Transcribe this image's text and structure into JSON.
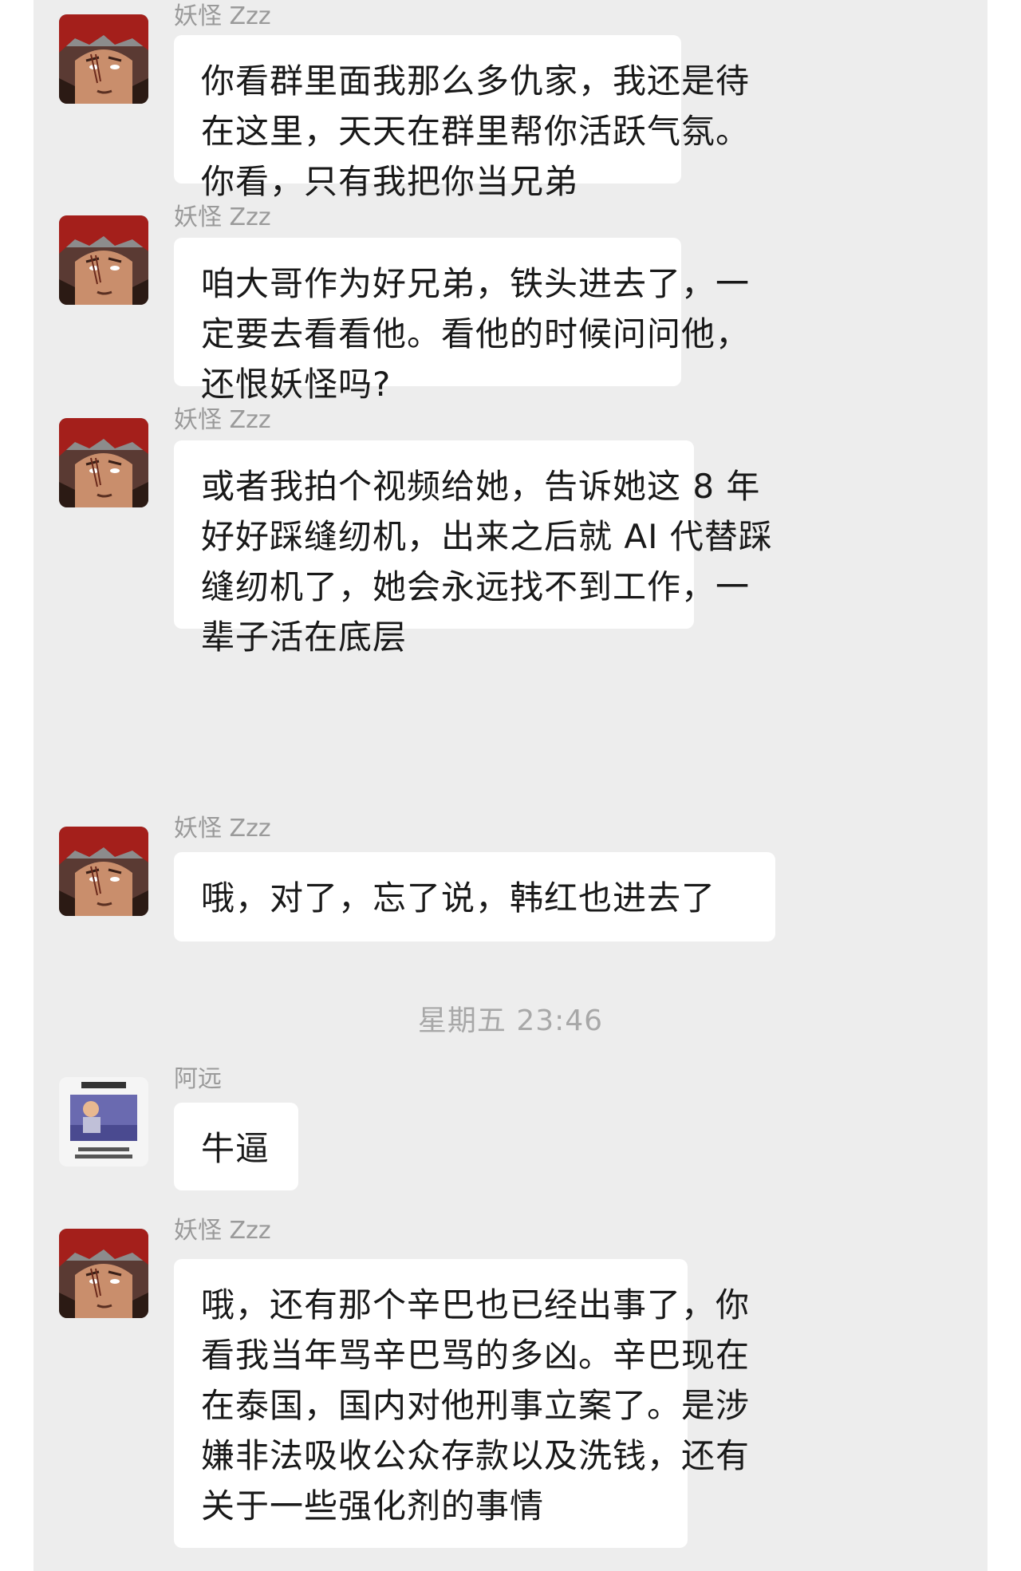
{
  "messages": [
    {
      "sender": "妖怪 Zzz",
      "avatar_icon": "red-haired-anime-avatar-icon",
      "lines": [
        "你看群里面我那么多仇家，我还是待",
        "在这里，天天在群里帮你活跃气氛。",
        "你看，只有我把你当兄弟"
      ]
    },
    {
      "sender": "妖怪 Zzz",
      "avatar_icon": "red-haired-anime-avatar-icon",
      "lines": [
        "咱大哥作为好兄弟，铁头进去了，一",
        "定要去看看他。看他的时候问问他，",
        "还恨妖怪吗?"
      ]
    },
    {
      "sender": "妖怪 Zzz",
      "avatar_icon": "red-haired-anime-avatar-icon",
      "lines": [
        "或者我拍个视频给她，告诉她这 8 年",
        "好好踩缝纫机，出来之后就 AI 代替踩",
        "缝纫机了，她会永远找不到工作，一",
        "辈子活在底层"
      ]
    },
    {
      "sender": "妖怪 Zzz",
      "avatar_icon": "red-haired-anime-avatar-icon",
      "lines": [
        "哦，对了，忘了说，韩红也进去了"
      ]
    },
    {
      "sender": "阿远",
      "avatar_icon": "meme-thumbnail-avatar-icon",
      "lines": [
        "牛逼"
      ]
    },
    {
      "sender": "妖怪 Zzz",
      "avatar_icon": "red-haired-anime-avatar-icon",
      "lines": [
        "哦，还有那个辛巴也已经出事了，你",
        "看我当年骂辛巴骂的多凶。辛巴现在",
        "在泰国，国内对他刑事立案了。是涉",
        "嫌非法吸收公众存款以及洗钱，还有",
        "关于一些强化剂的事情"
      ]
    }
  ],
  "timestamp": "星期五 23:46",
  "colors": {
    "chat_background": "#ededed",
    "bubble": "#ffffff",
    "sender_name": "#9a9a9a",
    "timestamp": "#a8a8a8",
    "message_text": "#191919"
  }
}
